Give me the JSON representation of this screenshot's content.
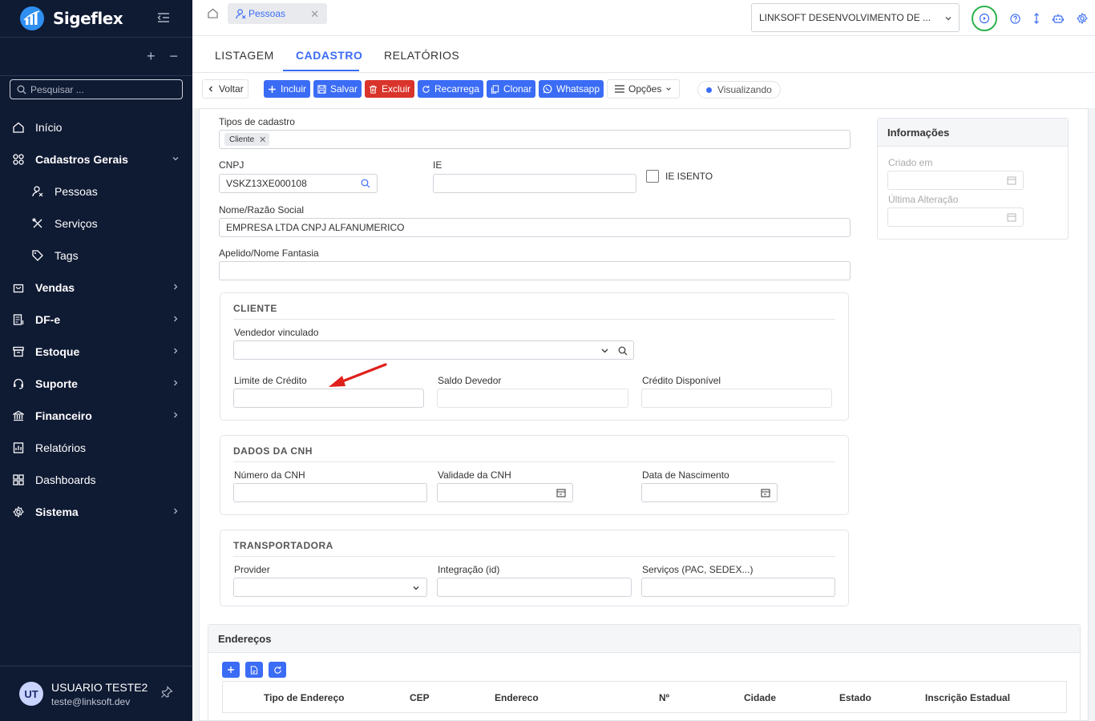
{
  "app": {
    "name": "Sigeflex"
  },
  "sidebar": {
    "search_placeholder": "Pesquisar ...",
    "items": [
      {
        "label": "Início",
        "icon": "home-icon"
      },
      {
        "label": "Cadastros Gerais",
        "icon": "grid-icon",
        "expanded": true
      },
      {
        "label": "Pessoas",
        "icon": "person-icon"
      },
      {
        "label": "Serviços",
        "icon": "tools-icon"
      },
      {
        "label": "Tags",
        "icon": "tag-icon"
      },
      {
        "label": "Vendas",
        "icon": "bag-icon"
      },
      {
        "label": "DF-e",
        "icon": "document-icon"
      },
      {
        "label": "Estoque",
        "icon": "box-icon"
      },
      {
        "label": "Suporte",
        "icon": "headset-icon"
      },
      {
        "label": "Financeiro",
        "icon": "bank-icon"
      },
      {
        "label": "Relatórios",
        "icon": "report-icon"
      },
      {
        "label": "Dashboards",
        "icon": "dashboard-icon"
      },
      {
        "label": "Sistema",
        "icon": "gear-icon"
      }
    ],
    "user": {
      "initials": "UT",
      "name": "USUARIO TESTE2",
      "email": "teste@linksoft.dev"
    }
  },
  "topbar": {
    "tab_label": "Pessoas",
    "company": "LINKSOFT DESENVOLVIMENTO DE ..."
  },
  "tabs": [
    "LISTAGEM",
    "CADASTRO",
    "RELATÓRIOS"
  ],
  "toolbar": {
    "back": "Voltar",
    "incluir": "Incluir",
    "salvar": "Salvar",
    "excluir": "Excluir",
    "recarrega": "Recarrega",
    "clonar": "Clonar",
    "whatsapp": "Whatsapp",
    "opcoes": "Opções",
    "status": "Visualizando"
  },
  "form": {
    "tipos_label": "Tipos de cadastro",
    "tipos_chip": "Cliente",
    "cnpj_label": "CNPJ",
    "cnpj_value": "VSKZ13XE000108",
    "ie_label": "IE",
    "ie_isento_label": "IE ISENTO",
    "nome_label": "Nome/Razão Social",
    "nome_value": "EMPRESA LTDA CNPJ ALFANUMERICO",
    "apelido_label": "Apelido/Nome Fantasia",
    "cliente": {
      "title": "CLIENTE",
      "vendedor_label": "Vendedor vinculado",
      "limite_label": "Limite de Crédito",
      "saldo_label": "Saldo Devedor",
      "credito_label": "Crédito Disponível"
    },
    "cnh": {
      "title": "DADOS DA CNH",
      "numero_label": "Número da CNH",
      "validade_label": "Validade da CNH",
      "nascimento_label": "Data de Nascimento"
    },
    "transportadora": {
      "title": "TRANSPORTADORA",
      "provider_label": "Provider",
      "integracao_label": "Integração (id)",
      "servicos_label": "Serviços (PAC, SEDEX...)"
    }
  },
  "info": {
    "title": "Informações",
    "criado_label": "Criado em",
    "alteracao_label": "Última Alteração"
  },
  "enderecos": {
    "title": "Endereços",
    "columns": [
      "Tipo de Endereço",
      "CEP",
      "Endereco",
      "Nº",
      "Cidade",
      "Estado",
      "Inscrição Estadual"
    ]
  },
  "colors": {
    "accent": "#3b6cf5",
    "danger": "#d9342b",
    "sidebar_bg": "#0f1a33",
    "annotation_arrow": "#e0201b",
    "highlight_ring": "#2bb24c"
  }
}
